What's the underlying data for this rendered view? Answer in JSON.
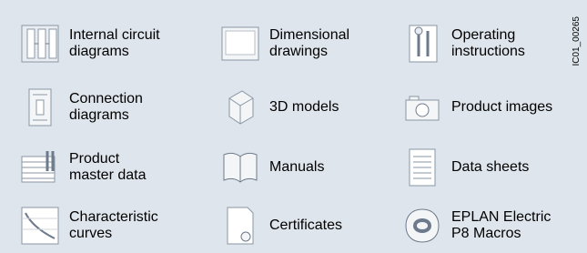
{
  "items": [
    {
      "label": "Internal circuit\ndiagrams",
      "icon": "circuit-icon"
    },
    {
      "label": "Dimensional\ndrawings",
      "icon": "drawing-icon"
    },
    {
      "label": "Operating\ninstructions",
      "icon": "tools-doc-icon"
    },
    {
      "label": "Connection\ndiagrams",
      "icon": "connection-icon"
    },
    {
      "label": "3D models",
      "icon": "cube-icon"
    },
    {
      "label": "Product images",
      "icon": "camera-icon"
    },
    {
      "label": "Product\nmaster data",
      "icon": "table-tools-icon"
    },
    {
      "label": "Manuals",
      "icon": "book-icon"
    },
    {
      "label": "Data sheets",
      "icon": "datasheet-icon"
    },
    {
      "label": "Characteristic\ncurves",
      "icon": "curve-icon"
    },
    {
      "label": "Certificates",
      "icon": "certificate-icon"
    },
    {
      "label": "EPLAN Electric\nP8 Macros",
      "icon": "eplan-icon"
    }
  ],
  "side_code": "IC01_00265"
}
